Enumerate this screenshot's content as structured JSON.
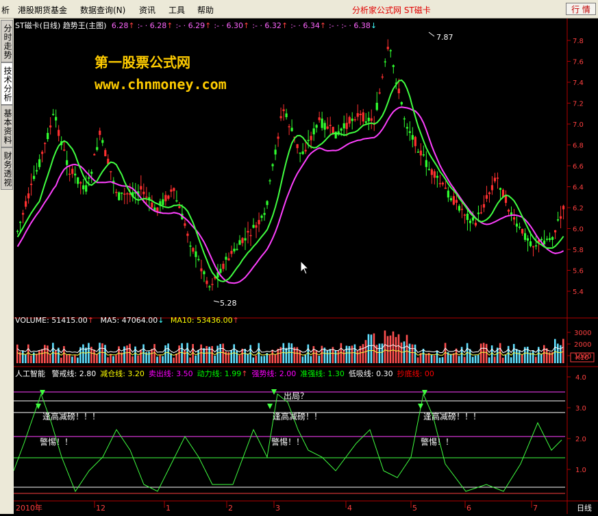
{
  "menubar": {
    "items": [
      "析",
      "港股期货基金",
      "数据查询(N)",
      "资讯",
      "工具",
      "帮助"
    ],
    "brand": "分析家公式网 ST磁卡",
    "quote_button": "行 情"
  },
  "left_tabs": [
    "分时走势",
    "技术分析",
    "基本资料",
    "财务透视"
  ],
  "main_panel": {
    "title": "ST磁卡(日线) 趋势王(主图)",
    "ma_values": [
      {
        "label": "6.28",
        "arrow": "↑"
      },
      {
        "label": ":- · 6.28",
        "arrow": "↑"
      },
      {
        "label": ":- · 6.29",
        "arrow": "↑"
      },
      {
        "label": ":- · 6.30",
        "arrow": "↑"
      },
      {
        "label": ":- · 6.32",
        "arrow": "↑"
      },
      {
        "label": ":- · 6.34",
        "arrow": "↑"
      },
      {
        "label": ":- · :- · 6.38",
        "arrow": "↓"
      }
    ],
    "watermark_title": "第一股票公式网",
    "watermark_url": "www.chnmoney.com",
    "high_label": "7.87",
    "low_label": "5.28",
    "y_ticks": [
      "7.8",
      "7.6",
      "7.4",
      "7.2",
      "7.0",
      "6.8",
      "6.6",
      "6.4",
      "6.2",
      "6.0",
      "5.8",
      "5.6",
      "5.4"
    ]
  },
  "volume_panel": {
    "volume_label": "VOLUME: 51415.00",
    "ma5_label": "MA5: 47064.00",
    "ma10_label": "MA10: 53436.00",
    "y_ticks": [
      "3000",
      "2000",
      "1000"
    ],
    "unit": "X10"
  },
  "indicator_panel": {
    "name": "人工智能",
    "params": [
      {
        "text": "警戒线: 2.80",
        "color": "#ffffff"
      },
      {
        "text": "减仓线: 3.20",
        "color": "#ffff00"
      },
      {
        "text": "卖出线: 3.50",
        "color": "#ff00ff"
      },
      {
        "text": "动力线: 1.99",
        "color": "#00ff00",
        "arrow": "↑"
      },
      {
        "text": "强势线: 2.00",
        "color": "#ff00ff"
      },
      {
        "text": "准强线: 1.30",
        "color": "#00ff00"
      },
      {
        "text": "低吸线: 0.30",
        "color": "#ffffff"
      },
      {
        "text": "抄底线: 00",
        "color": "#ff0000"
      }
    ],
    "annotations": {
      "signal_1": "逢高减磅！！！",
      "warn_1": "警惕！！",
      "exit": "出局？",
      "signal_2": "逢高减磅！！",
      "warn_2": "警惕！！",
      "signal_3": "逢高减磅！！！",
      "warn_3": "警惕！！"
    },
    "y_ticks": [
      "4.0",
      "3.0",
      "2.0",
      "1.0"
    ]
  },
  "x_axis": {
    "labels": [
      "2010年",
      "12",
      "1",
      "2",
      "3",
      "4",
      "5",
      "6",
      "7"
    ],
    "period": "日线"
  },
  "colors": {
    "up": "#ff3030",
    "down": "#30ff30",
    "ma_line": "#ff40ff",
    "trend_line": "#40ff40",
    "axis": "#b00000",
    "watermark": "#ffcc00"
  }
}
